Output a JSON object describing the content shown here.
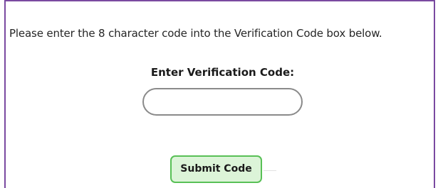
{
  "instruction_text": "Please enter the 8 character code into the Verification Code box below.",
  "verification": {
    "label": "Enter Verification Code:",
    "input_value": "",
    "input_placeholder": ""
  },
  "submit": {
    "label": "Submit Code"
  },
  "colors": {
    "frame_border": "#7a4aa0",
    "button_border": "#58c056",
    "button_fill": "#dcf4d8",
    "input_border": "#8a8a8a"
  }
}
